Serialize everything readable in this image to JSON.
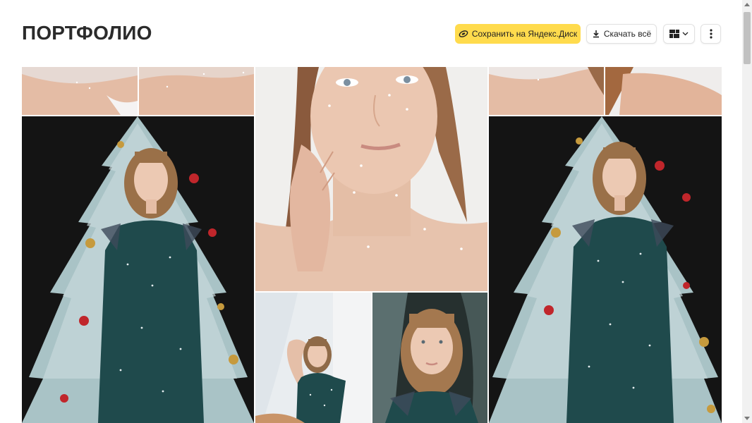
{
  "header": {
    "title": "ПОРТФОЛИО",
    "save_label": "Сохранить на Яндекс.Диск",
    "download_label": "Скачать всё"
  },
  "colors": {
    "save_button": "#ffdb4d",
    "dark_backdrop": "#141414",
    "dress": "#1f4a4c",
    "skin": "#e8c3ad",
    "light_backdrop": "#f2f1ef"
  },
  "icons": {
    "save": "disk-icon",
    "download": "download-icon",
    "layout": "grid-layout-icon",
    "dropdown": "chevron-down-icon",
    "more": "more-vertical-icon"
  },
  "gallery": {
    "photos": [
      {
        "name": "photo-shoulders-1"
      },
      {
        "name": "photo-shoulders-2"
      },
      {
        "name": "photo-face-closeup"
      },
      {
        "name": "photo-shoulders-3"
      },
      {
        "name": "photo-shoulders-4"
      },
      {
        "name": "photo-girl-tree-left"
      },
      {
        "name": "photo-girl-tree-right"
      },
      {
        "name": "photo-girl-light-room"
      },
      {
        "name": "photo-girl-portrait"
      }
    ]
  }
}
